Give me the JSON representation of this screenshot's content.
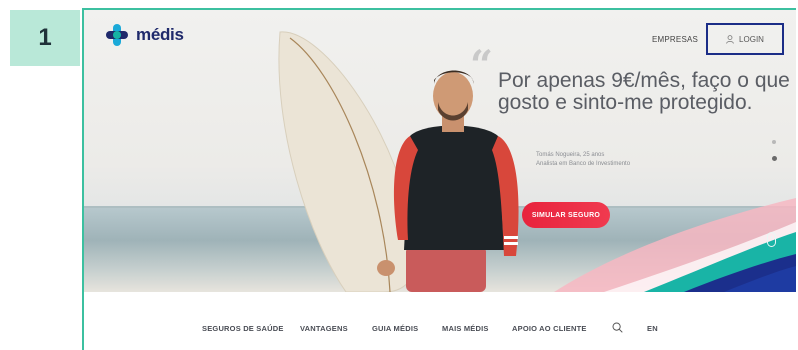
{
  "step": "1",
  "header": {
    "logo_text": "médis",
    "nav_empresas": "EMPRESAS",
    "login_label": "LOGIN"
  },
  "hero": {
    "headline": "Por apenas 9€/mês, faço o que gosto e sinto-me protegido.",
    "person_name": "Tomás Nogueira, 25 anos",
    "person_role": "Analista em Banco de Investimento",
    "cta_label": "SIMULAR SEGURO"
  },
  "bottom_nav": {
    "items": [
      "SEGUROS DE SAÚDE",
      "VANTAGENS",
      "GUIA MÉDIS",
      "MAIS MÉDIS",
      "APOIO AO CLIENTE"
    ],
    "lang": "EN"
  },
  "icons": {
    "search": "search-icon",
    "user": "user-icon",
    "scroll": "mouse-scroll-icon"
  },
  "colors": {
    "brand_navy": "#1f2a6b",
    "cta_red": "#e8233d",
    "teal": "#17b3a3",
    "frame_border": "#3cc0a0"
  }
}
